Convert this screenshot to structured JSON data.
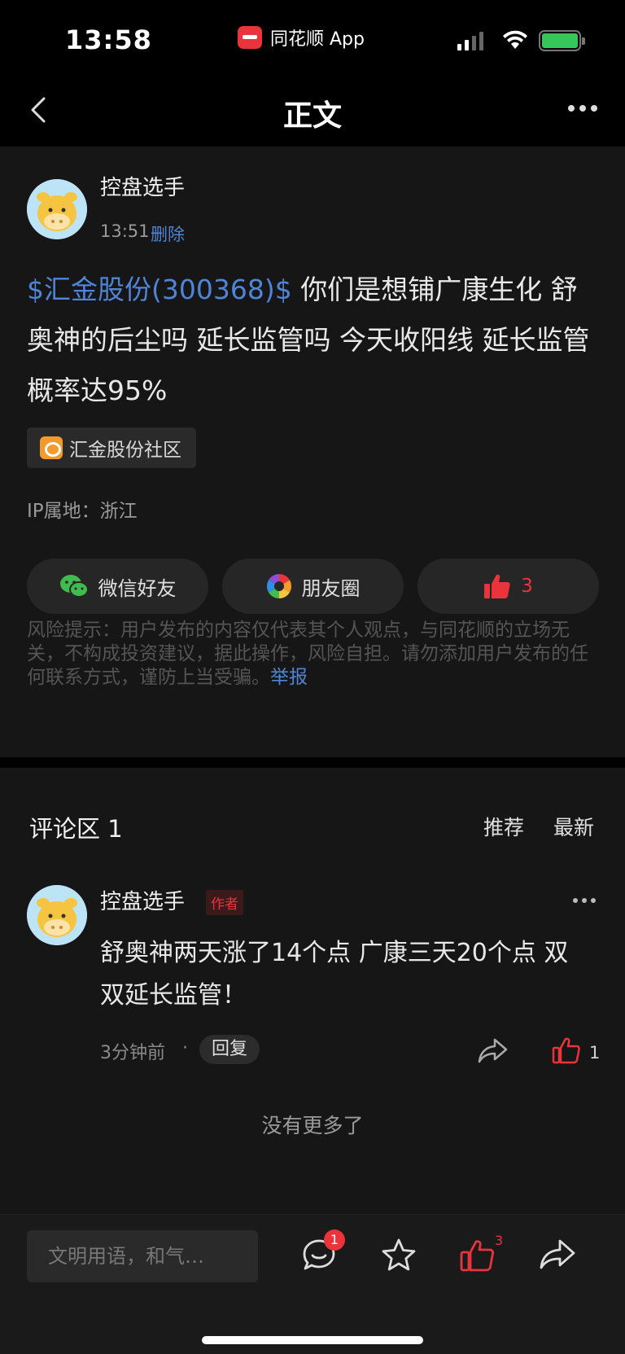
{
  "status_bar": {
    "time": "13:58",
    "app_name": "同花顺 App"
  },
  "nav": {
    "title": "正文"
  },
  "post": {
    "author": "控盘选手",
    "time": "13:51",
    "delete_label": "删除",
    "stock_link": "$汇金股份(300368)$",
    "body": " 你们是想铺广康生化 舒奥神的后尘吗 延长监管吗 今天收阳线 延长监管概率达95%",
    "community": "汇金股份社区",
    "ip_location": "IP属地：浙江",
    "share_wechat": "微信好友",
    "share_moments": "朋友圈",
    "like_count": "3",
    "risk_text": "风险提示：用户发布的内容仅代表其个人观点，与同花顺的立场无关，不构成投资建议，据此操作，风险自担。请勿添加用户发布的任何联系方式，谨防上当受骗。",
    "report_label": "举报"
  },
  "comments": {
    "title": "评论区 1",
    "sort_recommend": "推荐",
    "sort_latest": "最新",
    "items": [
      {
        "author": "控盘选手",
        "tag": "作者",
        "text": "舒奥神两天涨了14个点 广康三天20个点 双双延长监管！",
        "time": "3分钟前",
        "dot": "·",
        "reply_label": "回复",
        "like_count": "1"
      }
    ],
    "no_more": "没有更多了"
  },
  "bottom_bar": {
    "input_placeholder": "文明用语，和气…",
    "comment_badge": "1",
    "like_count": "3"
  },
  "colors": {
    "accent_red": "#e8343a",
    "link_blue": "#4f84d6",
    "card_bg": "#161616"
  }
}
